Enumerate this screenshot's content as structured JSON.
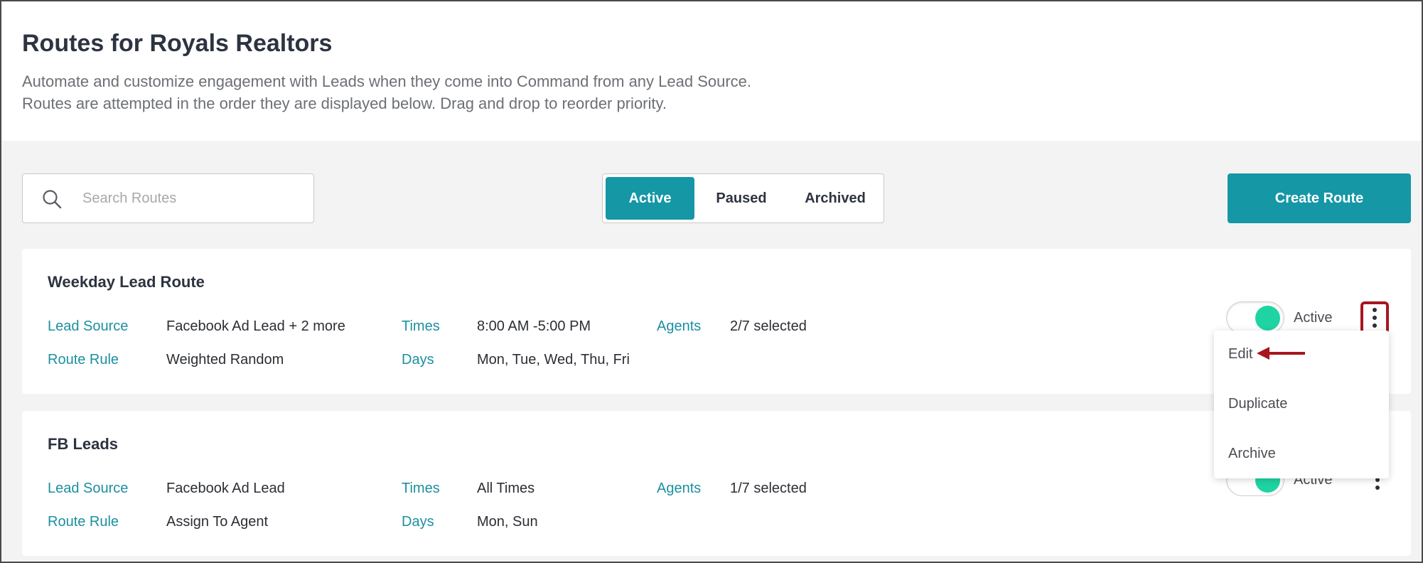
{
  "header": {
    "title": "Routes for Royals Realtors",
    "description_line1": "Automate and customize engagement with Leads when they come into Command from any Lead Source.",
    "description_line2": "Routes are attempted in the order they are displayed below. Drag and drop to reorder priority."
  },
  "toolbar": {
    "search_placeholder": "Search Routes",
    "search_icon": "search-icon",
    "tabs": [
      {
        "label": "Active",
        "selected": true
      },
      {
        "label": "Paused",
        "selected": false
      },
      {
        "label": "Archived",
        "selected": false
      }
    ],
    "create_label": "Create Route"
  },
  "routes": [
    {
      "name": "Weekday Lead Route",
      "lead_source_label": "Lead Source",
      "lead_source": "Facebook Ad Lead + 2 more",
      "times_label": "Times",
      "times": "8:00 AM -5:00 PM",
      "agents_label": "Agents",
      "agents": "2/7 selected",
      "route_rule_label": "Route Rule",
      "route_rule": "Weighted Random",
      "days_label": "Days",
      "days": "Mon, Tue, Wed, Thu, Fri",
      "status": "Active"
    },
    {
      "name": "FB Leads",
      "lead_source_label": "Lead Source",
      "lead_source": "Facebook Ad Lead",
      "times_label": "Times",
      "times": "All Times",
      "agents_label": "Agents",
      "agents": "1/7 selected",
      "route_rule_label": "Route Rule",
      "route_rule": "Assign To Agent",
      "days_label": "Days",
      "days": "Mon, Sun",
      "status": "Active"
    }
  ],
  "menu": {
    "items": [
      "Edit",
      "Duplicate",
      "Archive"
    ]
  },
  "colors": {
    "accent": "#1597a6",
    "toggle_on": "#1ed4a2",
    "highlight": "#a8161f",
    "label": "#1d8fa0"
  }
}
